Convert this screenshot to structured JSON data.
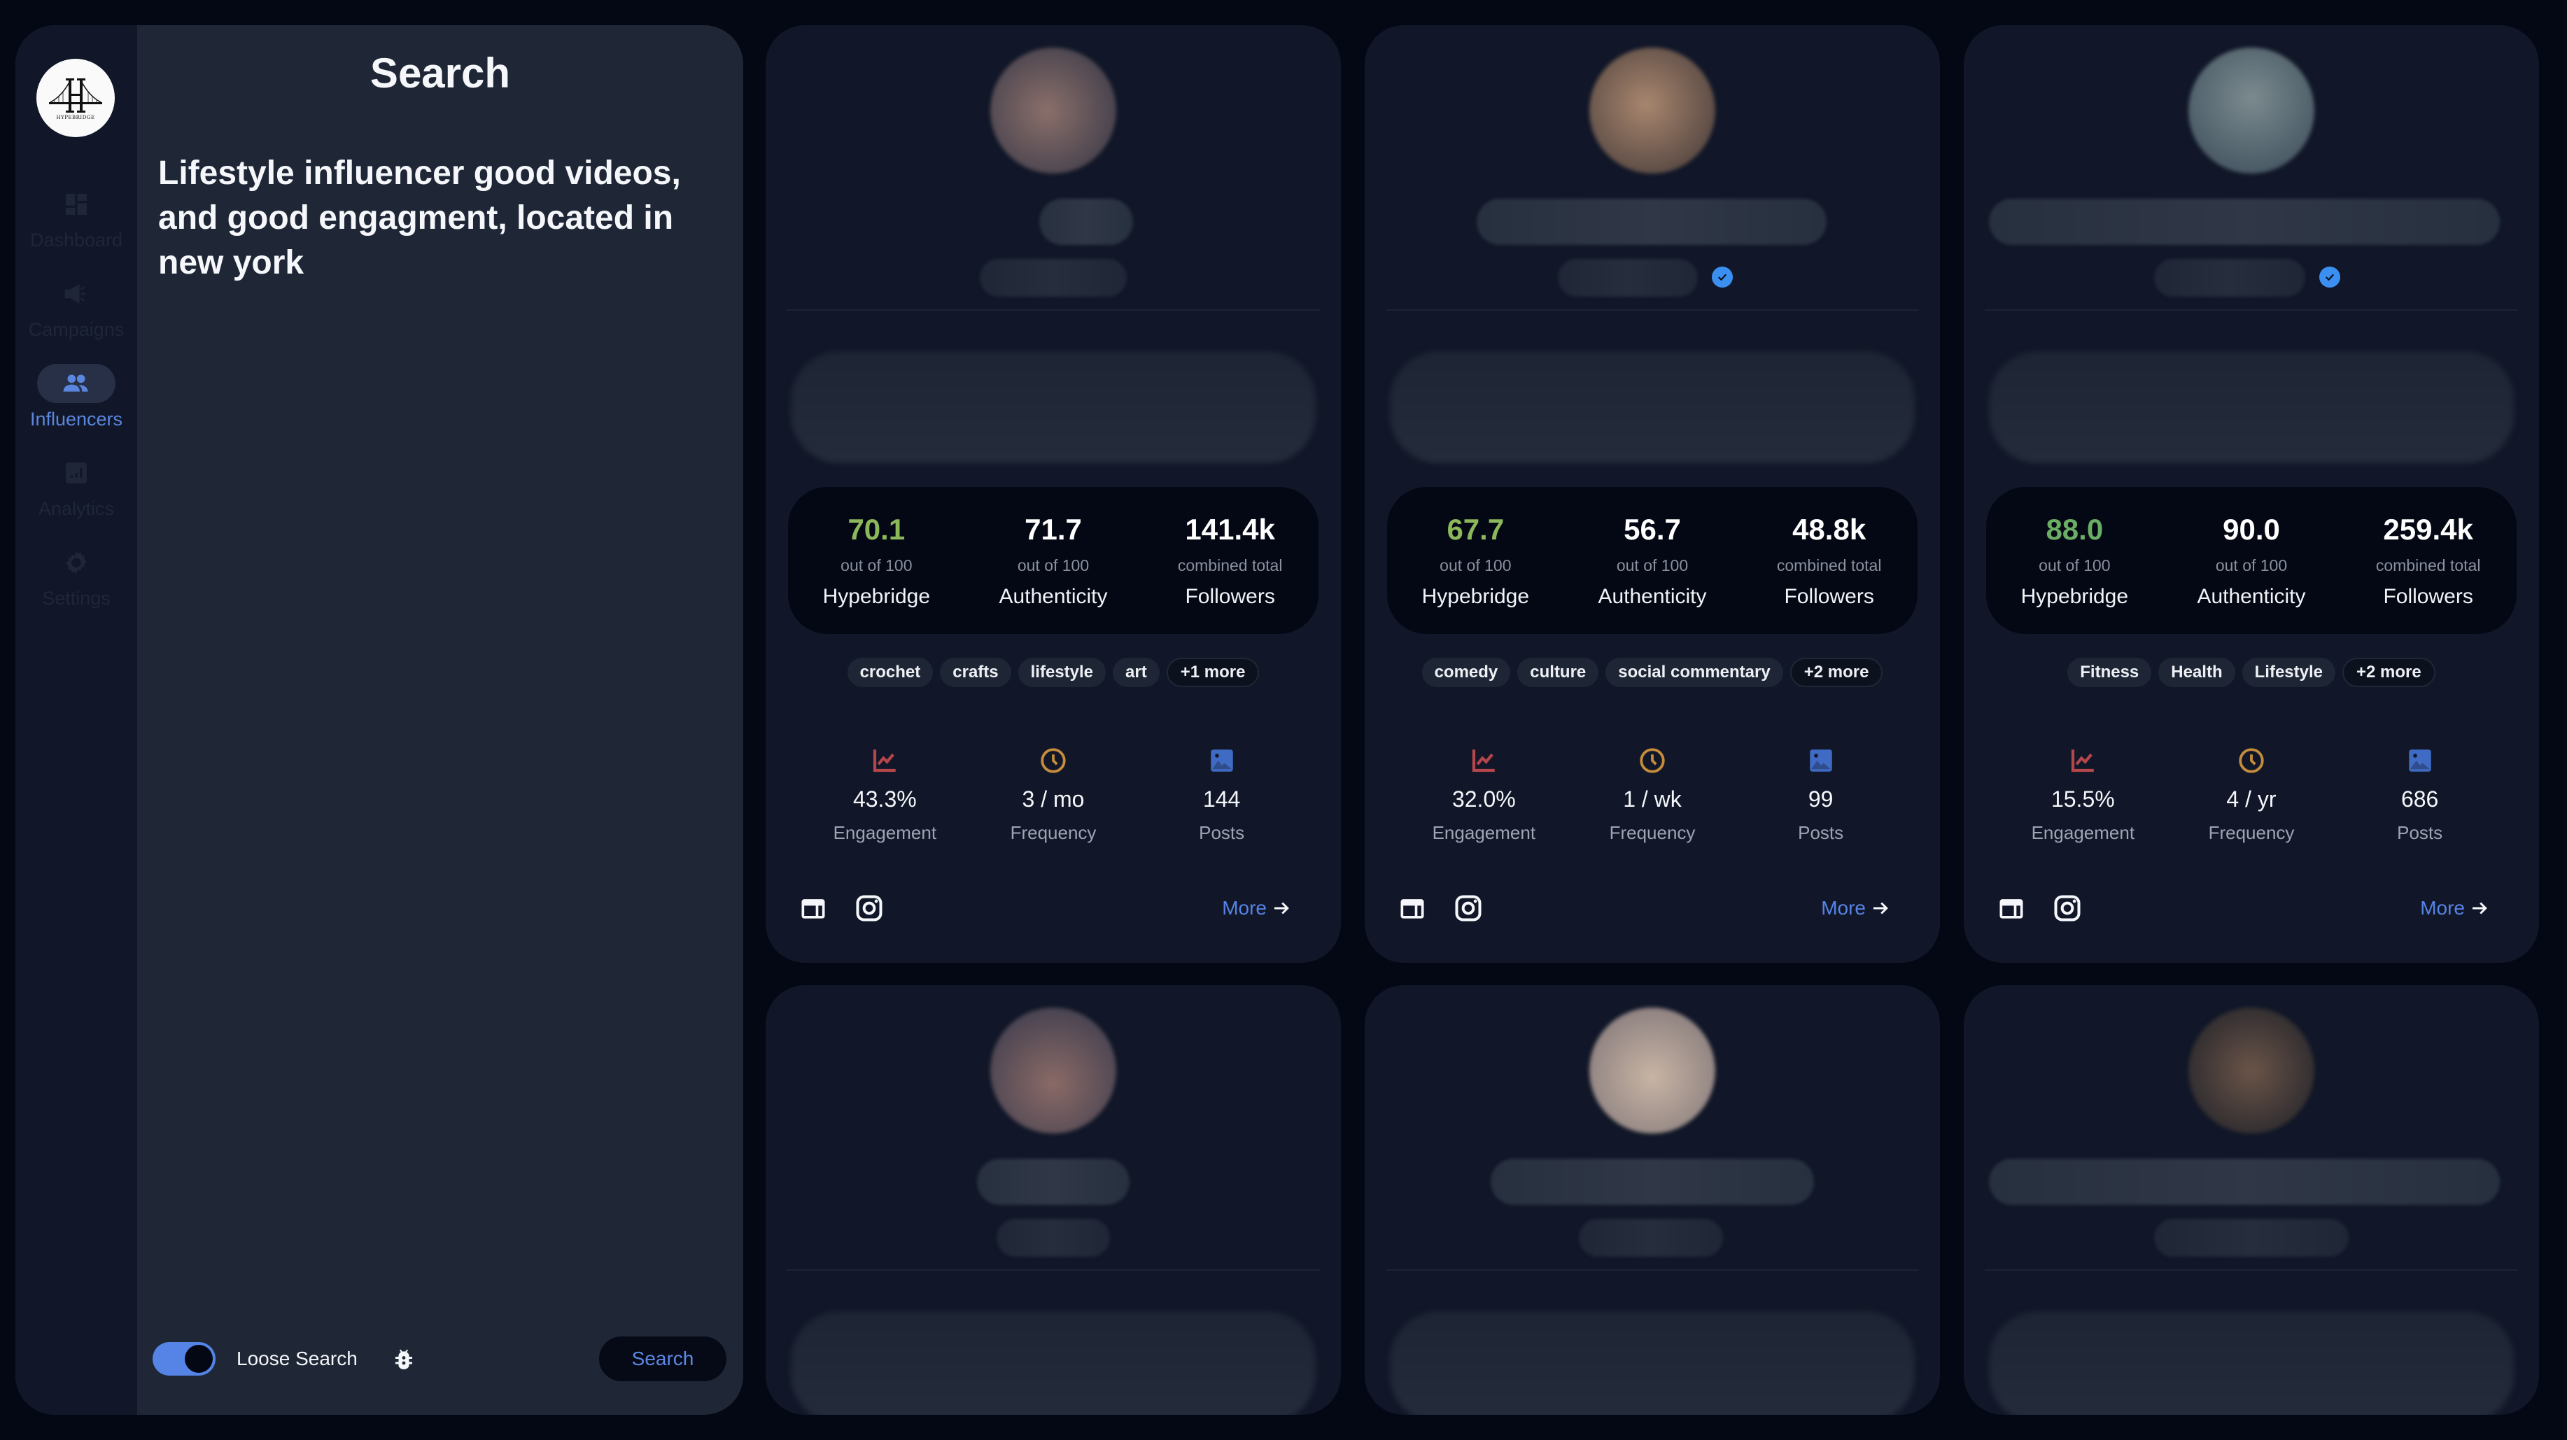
{
  "sidebar": {
    "logo_text": "HYPEBRIDGE",
    "items": [
      {
        "label": "Dashboard",
        "icon": "dashboard-icon",
        "active": false
      },
      {
        "label": "Campaigns",
        "icon": "megaphone-icon",
        "active": false
      },
      {
        "label": "Influencers",
        "icon": "people-icon",
        "active": true
      },
      {
        "label": "Analytics",
        "icon": "analytics-icon",
        "active": false
      },
      {
        "label": "Settings",
        "icon": "gear-icon",
        "active": false
      }
    ]
  },
  "search": {
    "title": "Search",
    "query": "Lifestyle influencer good videos, and good engagment, located in new york",
    "loose_search_label": "Loose Search",
    "loose_search_on": true,
    "search_button": "Search"
  },
  "colors": {
    "accent": "#5583e6",
    "score_green": "#8cb85c",
    "engagement_icon": "#b5464c",
    "frequency_icon": "#c48c3c",
    "posts_icon": "#3f6bc4",
    "verified": "#3b8ff0"
  },
  "labels": {
    "out_of": "out of 100",
    "combined": "combined total",
    "hypebridge": "Hypebridge",
    "authenticity": "Authenticity",
    "followers": "Followers",
    "engagement": "Engagement",
    "frequency": "Frequency",
    "posts": "Posts",
    "more": "More"
  },
  "cards": [
    {
      "verified": false,
      "hypebridge": "70.1",
      "authenticity": "71.7",
      "followers": "141.4k",
      "tags": [
        "crochet",
        "crafts",
        "lifestyle",
        "art"
      ],
      "more_tags": "+1 more",
      "engagement": "43.3%",
      "frequency": "3 / mo",
      "posts": "144"
    },
    {
      "verified": true,
      "hypebridge": "67.7",
      "authenticity": "56.7",
      "followers": "48.8k",
      "tags": [
        "comedy",
        "culture",
        "social commentary"
      ],
      "more_tags": "+2 more",
      "engagement": "32.0%",
      "frequency": "1 / wk",
      "posts": "99"
    },
    {
      "verified": true,
      "hypebridge": "88.0",
      "authenticity": "90.0",
      "followers": "259.4k",
      "tags": [
        "Fitness",
        "Health",
        "Lifestyle"
      ],
      "more_tags": "+2 more",
      "engagement": "15.5%",
      "frequency": "4 / yr",
      "posts": "686"
    },
    {
      "verified": false
    },
    {
      "verified": false
    },
    {
      "verified": false
    }
  ]
}
